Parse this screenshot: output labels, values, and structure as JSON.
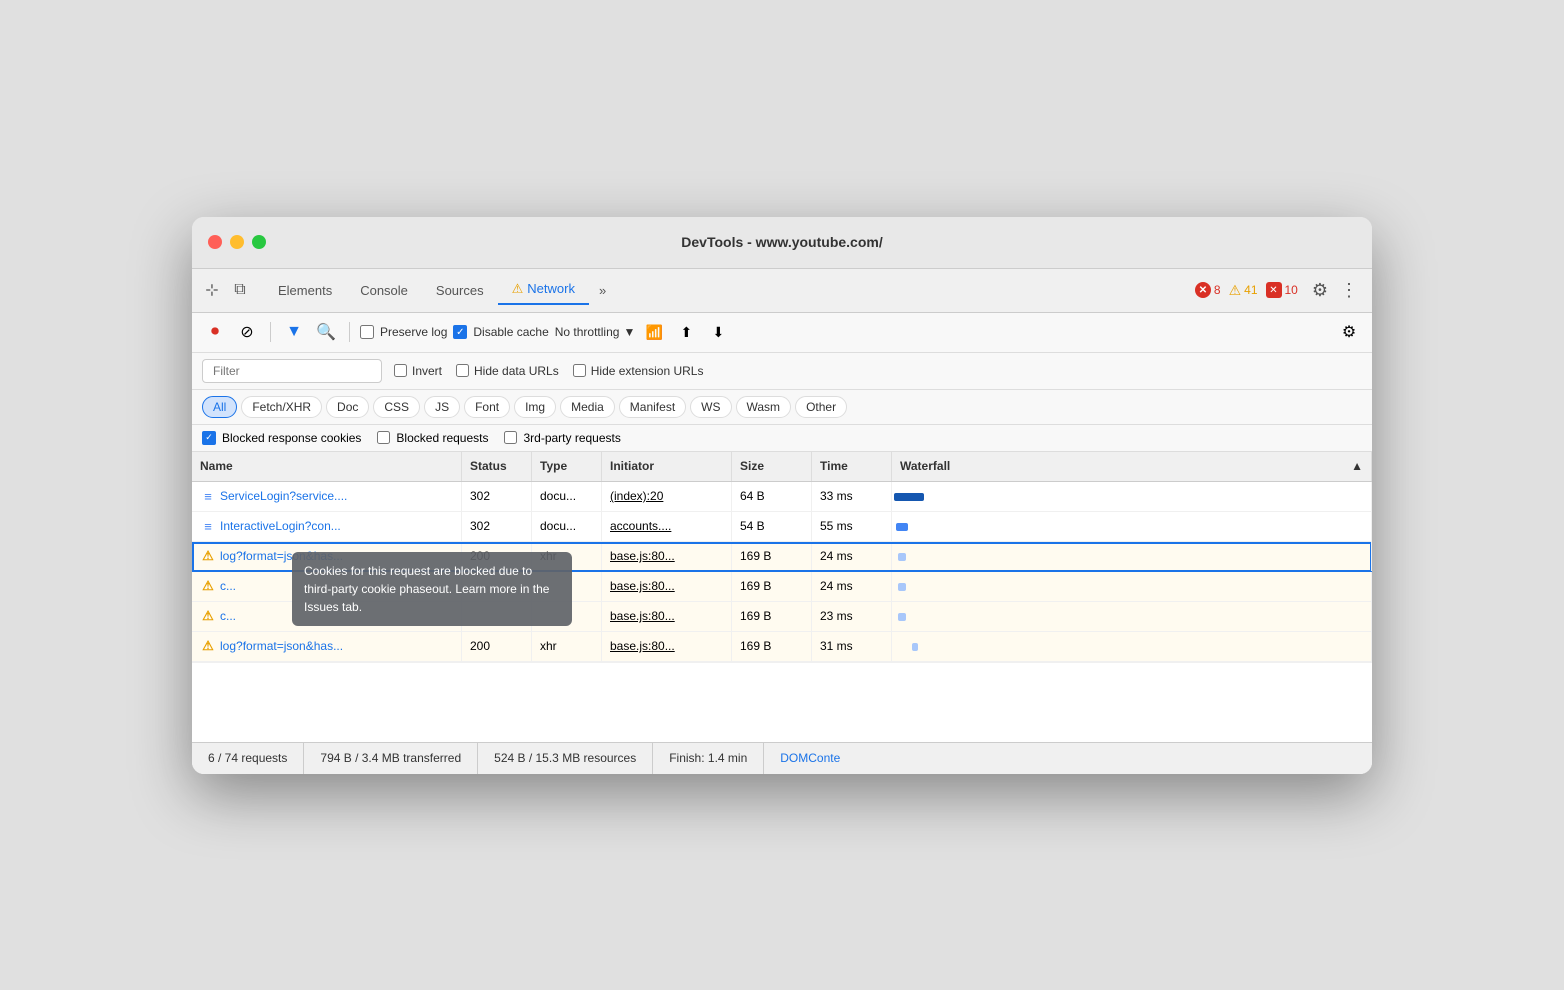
{
  "window": {
    "title": "DevTools - www.youtube.com/"
  },
  "tabs": {
    "items": [
      {
        "label": "Elements",
        "active": false
      },
      {
        "label": "Console",
        "active": false
      },
      {
        "label": "Sources",
        "active": false
      },
      {
        "label": "Network",
        "active": true,
        "warning": true
      },
      {
        "label": "»",
        "active": false
      }
    ]
  },
  "badges": {
    "error_icon": "✕",
    "error_count": "8",
    "warn_icon": "⚠",
    "warn_count": "41",
    "err2_count": "10"
  },
  "toolbar": {
    "preserve_log": "Preserve log",
    "disable_cache": "Disable cache",
    "no_throttling": "No throttling",
    "filter_placeholder": "Filter"
  },
  "filter_options": {
    "invert": "Invert",
    "hide_data_urls": "Hide data URLs",
    "hide_ext_urls": "Hide extension URLs"
  },
  "type_buttons": [
    {
      "label": "All",
      "active": true
    },
    {
      "label": "Fetch/XHR",
      "active": false
    },
    {
      "label": "Doc",
      "active": false
    },
    {
      "label": "CSS",
      "active": false
    },
    {
      "label": "JS",
      "active": false
    },
    {
      "label": "Font",
      "active": false
    },
    {
      "label": "Img",
      "active": false
    },
    {
      "label": "Media",
      "active": false
    },
    {
      "label": "Manifest",
      "active": false
    },
    {
      "label": "WS",
      "active": false
    },
    {
      "label": "Wasm",
      "active": false
    },
    {
      "label": "Other",
      "active": false
    }
  ],
  "blocked_row": {
    "item1": "Blocked response cookies",
    "item2": "Blocked requests",
    "item3": "3rd-party requests"
  },
  "table": {
    "headers": [
      "Name",
      "Status",
      "Type",
      "Initiator",
      "Size",
      "Time",
      "Waterfall"
    ],
    "rows": [
      {
        "icon": "doc",
        "name": "ServiceLogin?service....",
        "status": "302",
        "type": "docu...",
        "initiator": "(index):20",
        "size": "64 B",
        "time": "33 ms",
        "warn": false
      },
      {
        "icon": "doc",
        "name": "InteractiveLogin?con...",
        "status": "302",
        "type": "docu...",
        "initiator": "accounts....",
        "size": "54 B",
        "time": "55 ms",
        "warn": false
      },
      {
        "icon": "warn",
        "name": "log?format=json&has...",
        "status": "200",
        "type": "xhr",
        "initiator": "base.js:80...",
        "size": "169 B",
        "time": "24 ms",
        "warn": true,
        "selected": true
      },
      {
        "icon": "warn",
        "name": "c...",
        "status": "",
        "type": "",
        "initiator": "base.js:80...",
        "size": "169 B",
        "time": "24 ms",
        "warn": true
      },
      {
        "icon": "warn",
        "name": "c...",
        "status": "",
        "type": "",
        "initiator": "base.js:80...",
        "size": "169 B",
        "time": "23 ms",
        "warn": true
      },
      {
        "icon": "warn",
        "name": "log?format=json&has...",
        "status": "200",
        "type": "xhr",
        "initiator": "base.js:80...",
        "size": "169 B",
        "time": "31 ms",
        "warn": true
      }
    ]
  },
  "tooltip": {
    "text": "Cookies for this request are blocked due to third-party cookie phaseout. Learn more in the Issues tab."
  },
  "status_bar": {
    "requests": "6 / 74 requests",
    "transferred": "794 B / 3.4 MB transferred",
    "resources": "524 B / 15.3 MB resources",
    "finish": "Finish: 1.4 min",
    "domconte": "DOMConte"
  }
}
